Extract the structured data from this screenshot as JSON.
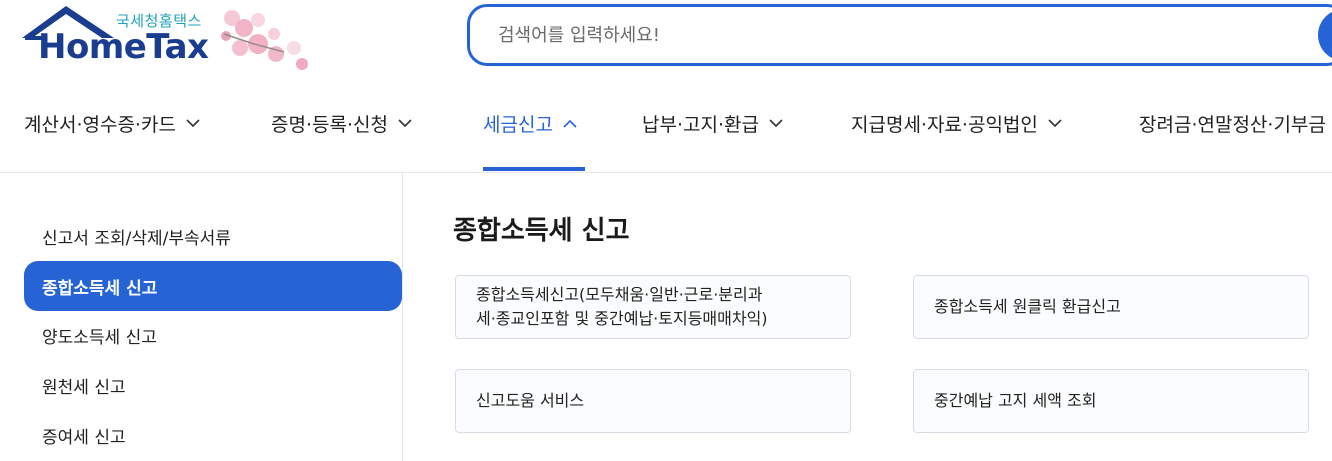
{
  "logo": {
    "korean": "국세청홈택스",
    "english": "HomeTax"
  },
  "search": {
    "placeholder": "검색어를 입력하세요!"
  },
  "gnb": {
    "items": [
      {
        "label": "계산서·영수증·카드"
      },
      {
        "label": "증명·등록·신청"
      },
      {
        "label": "세금신고"
      },
      {
        "label": "납부·고지·환급"
      },
      {
        "label": "지급명세·자료·공익법인"
      },
      {
        "label": "장려금·연말정산·기부금"
      }
    ]
  },
  "sidebar": {
    "items": [
      {
        "label": "신고서 조회/삭제/부속서류"
      },
      {
        "label": "종합소득세 신고"
      },
      {
        "label": "양도소득세 신고"
      },
      {
        "label": "원천세 신고"
      },
      {
        "label": "증여세 신고"
      }
    ]
  },
  "main": {
    "title": "종합소득세 신고",
    "cards": [
      {
        "line1": "종합소득세신고(모두채움·일반·근로·분리과",
        "line2": "세·종교인포함 및 중간예납·토지등매매차익)"
      },
      {
        "line1": "종합소득세 원클릭 환급신고"
      },
      {
        "line1": "신고도움 서비스"
      },
      {
        "line1": "중간예납 고지 세액 조회"
      }
    ]
  },
  "colors": {
    "accent": "#2664d6",
    "logo_navy": "#1b3d8f",
    "logo_teal": "#1fa3b8"
  }
}
